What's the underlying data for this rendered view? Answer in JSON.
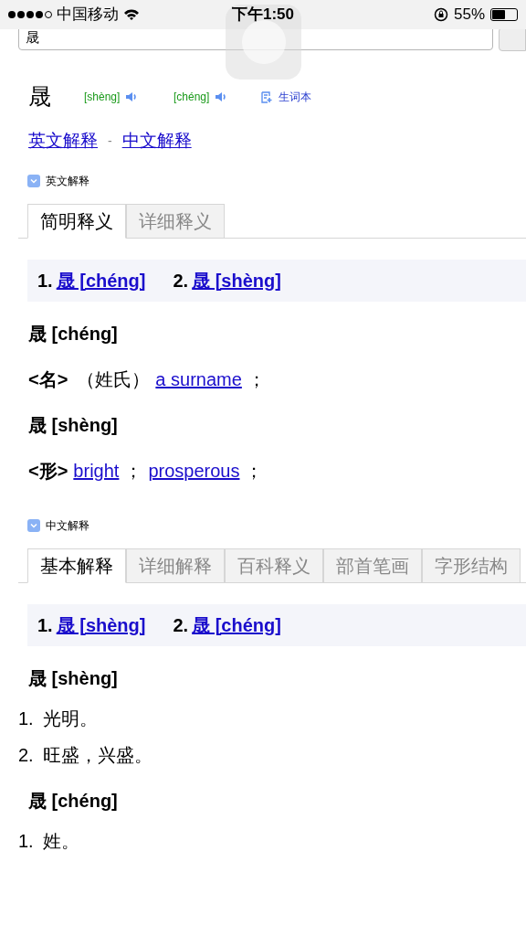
{
  "status_bar": {
    "carrier": "中国移动",
    "time": "下午1:50",
    "battery": "55%"
  },
  "search": {
    "value": "晟"
  },
  "headword": {
    "text": "晟",
    "pronunciations": [
      {
        "pinyin": "[shèng]"
      },
      {
        "pinyin": "[chéng]"
      }
    ],
    "wordbook": "生词本"
  },
  "nav": {
    "links": [
      "英文解释",
      "中文解释"
    ],
    "separator": "-"
  },
  "sections": [
    {
      "title": "英文解释",
      "tabs": [
        {
          "label": "简明释义",
          "selected": true
        },
        {
          "label": "详细释义",
          "selected": false
        }
      ],
      "index": [
        {
          "number": "1.",
          "link": "晟 [chéng]"
        },
        {
          "number": "2.",
          "link": "晟 [shèng]"
        }
      ],
      "entries": [
        {
          "heading": "晟 [chéng]",
          "lines": [
            [
              {
                "kind": "pos",
                "text": "<名>"
              },
              {
                "kind": "text",
                "text": "（姓氏）"
              },
              {
                "kind": "link",
                "text": "a surname"
              },
              {
                "kind": "text",
                "text": "；"
              }
            ]
          ]
        },
        {
          "heading": "晟 [shèng]",
          "lines": [
            [
              {
                "kind": "pos",
                "text": "<形>"
              },
              {
                "kind": "link",
                "text": "bright"
              },
              {
                "kind": "text",
                "text": "；"
              },
              {
                "kind": "link",
                "text": "prosperous"
              },
              {
                "kind": "text",
                "text": "；"
              }
            ]
          ]
        }
      ]
    },
    {
      "title": "中文解释",
      "tabs": [
        {
          "label": "基本解释",
          "selected": true
        },
        {
          "label": "详细解释",
          "selected": false
        },
        {
          "label": "百科释义",
          "selected": false
        },
        {
          "label": "部首笔画",
          "selected": false
        },
        {
          "label": "字形结构",
          "selected": false
        }
      ],
      "index": [
        {
          "number": "1.",
          "link": "晟 [shèng]"
        },
        {
          "number": "2.",
          "link": "晟 [chéng]"
        }
      ],
      "entries": [
        {
          "heading": "晟 [shèng]",
          "items": [
            {
              "number": "1.",
              "text": "光明。"
            },
            {
              "number": "2.",
              "text": "旺盛，兴盛。"
            }
          ]
        },
        {
          "heading": "晟 [chéng]",
          "items": [
            {
              "number": "1.",
              "text": "姓。"
            }
          ]
        }
      ]
    }
  ]
}
